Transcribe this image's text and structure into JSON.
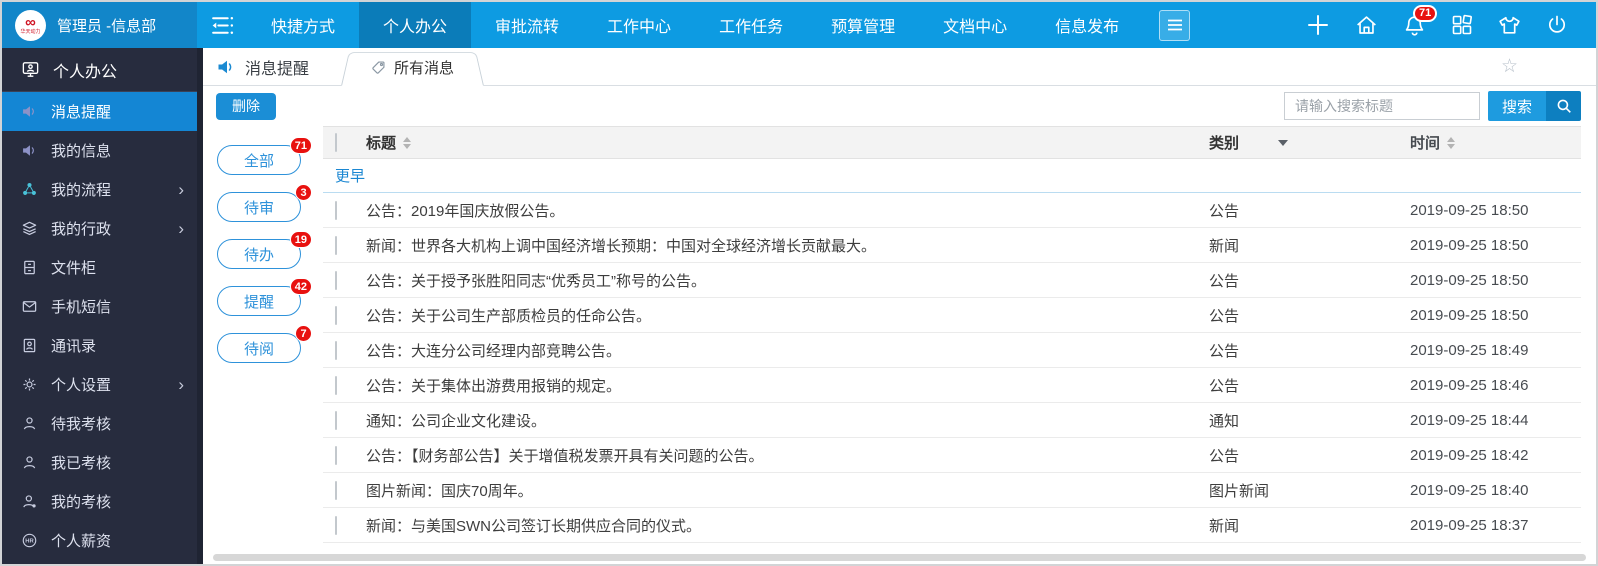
{
  "colors": {
    "accent": "#0d9be2",
    "topbar_left": "#1286c9",
    "nav_active": "#0b7cb9",
    "sidebar_bg": "#272c3e",
    "sidebar_selected": "#1486d4",
    "badge_red": "#e8110f",
    "pill_blue": "#2e92da",
    "link_blue": "#1b87d2",
    "button_blue": "#1b8ed6",
    "search_btn": "#1e9bdf",
    "search_btn_dark": "#0d7fc0"
  },
  "topbar": {
    "logo_text": "华天动力",
    "logo_symbol": "∞",
    "user": "管理员 -信息部",
    "bell_badge": "71",
    "nav": [
      {
        "label": "快捷方式",
        "active": false
      },
      {
        "label": "个人办公",
        "active": true
      },
      {
        "label": "审批流转",
        "active": false
      },
      {
        "label": "工作中心",
        "active": false
      },
      {
        "label": "工作任务",
        "active": false
      },
      {
        "label": "预算管理",
        "active": false
      },
      {
        "label": "文档中心",
        "active": false
      },
      {
        "label": "信息发布",
        "active": false
      }
    ],
    "icons": [
      "plus",
      "home",
      "bell",
      "app-grid",
      "shirt",
      "power"
    ]
  },
  "sidebar": {
    "header": "个人办公",
    "items": [
      {
        "label": "消息提醒",
        "icon": "speaker",
        "selected": true,
        "arrow": false
      },
      {
        "label": "我的信息",
        "icon": "speaker",
        "selected": false,
        "arrow": false
      },
      {
        "label": "我的流程",
        "icon": "flow",
        "selected": false,
        "arrow": true
      },
      {
        "label": "我的行政",
        "icon": "layers",
        "selected": false,
        "arrow": true
      },
      {
        "label": "文件柜",
        "icon": "cabinet",
        "selected": false,
        "arrow": false
      },
      {
        "label": "手机短信",
        "icon": "sms",
        "selected": false,
        "arrow": false
      },
      {
        "label": "通讯录",
        "icon": "contacts",
        "selected": false,
        "arrow": false
      },
      {
        "label": "个人设置",
        "icon": "gear",
        "selected": false,
        "arrow": true
      },
      {
        "label": "待我考核",
        "icon": "person",
        "selected": false,
        "arrow": false
      },
      {
        "label": "我已考核",
        "icon": "person",
        "selected": false,
        "arrow": false
      },
      {
        "label": "我的考核",
        "icon": "person-check",
        "selected": false,
        "arrow": false
      },
      {
        "label": "个人薪资",
        "icon": "hr",
        "selected": false,
        "arrow": false
      }
    ]
  },
  "content": {
    "breadcrumb_title": "消息提醒",
    "tab_label": "所有消息",
    "favorite_icon": "☆",
    "delete_label": "删除",
    "search": {
      "placeholder": "请输入搜索标题",
      "button": "搜索"
    },
    "filters": [
      {
        "label": "全部",
        "badge": "71"
      },
      {
        "label": "待审",
        "badge": "3"
      },
      {
        "label": "待办",
        "badge": "19"
      },
      {
        "label": "提醒",
        "badge": "42"
      },
      {
        "label": "待阅",
        "badge": "7"
      }
    ],
    "table": {
      "columns": {
        "title": "标题",
        "category": "类别",
        "time": "时间"
      },
      "group_label": "更早",
      "rows": [
        {
          "title": "公告：2019年国庆放假公告。",
          "category": "公告",
          "time": "2019-09-25 18:50"
        },
        {
          "title": "新闻：世界各大机构上调中国经济增长预期：中国对全球经济增长贡献最大。",
          "category": "新闻",
          "time": "2019-09-25 18:50"
        },
        {
          "title": "公告：关于授予张胜阳同志“优秀员工”称号的公告。",
          "category": "公告",
          "time": "2019-09-25 18:50"
        },
        {
          "title": "公告：关于公司生产部质检员的任命公告。",
          "category": "公告",
          "time": "2019-09-25 18:50"
        },
        {
          "title": "公告：大连分公司经理内部竞聘公告。",
          "category": "公告",
          "time": "2019-09-25 18:49"
        },
        {
          "title": "公告：关于集体出游费用报销的规定。",
          "category": "公告",
          "time": "2019-09-25 18:46"
        },
        {
          "title": "通知：公司企业文化建设。",
          "category": "通知",
          "time": "2019-09-25 18:44"
        },
        {
          "title": "公告：【财务部公告】关于增值税发票开具有关问题的公告。",
          "category": "公告",
          "time": "2019-09-25 18:42"
        },
        {
          "title": "图片新闻：国庆70周年。",
          "category": "图片新闻",
          "time": "2019-09-25 18:40"
        },
        {
          "title": "新闻：与美国SWN公司签订长期供应合同的仪式。",
          "category": "新闻",
          "time": "2019-09-25 18:37"
        }
      ]
    }
  }
}
